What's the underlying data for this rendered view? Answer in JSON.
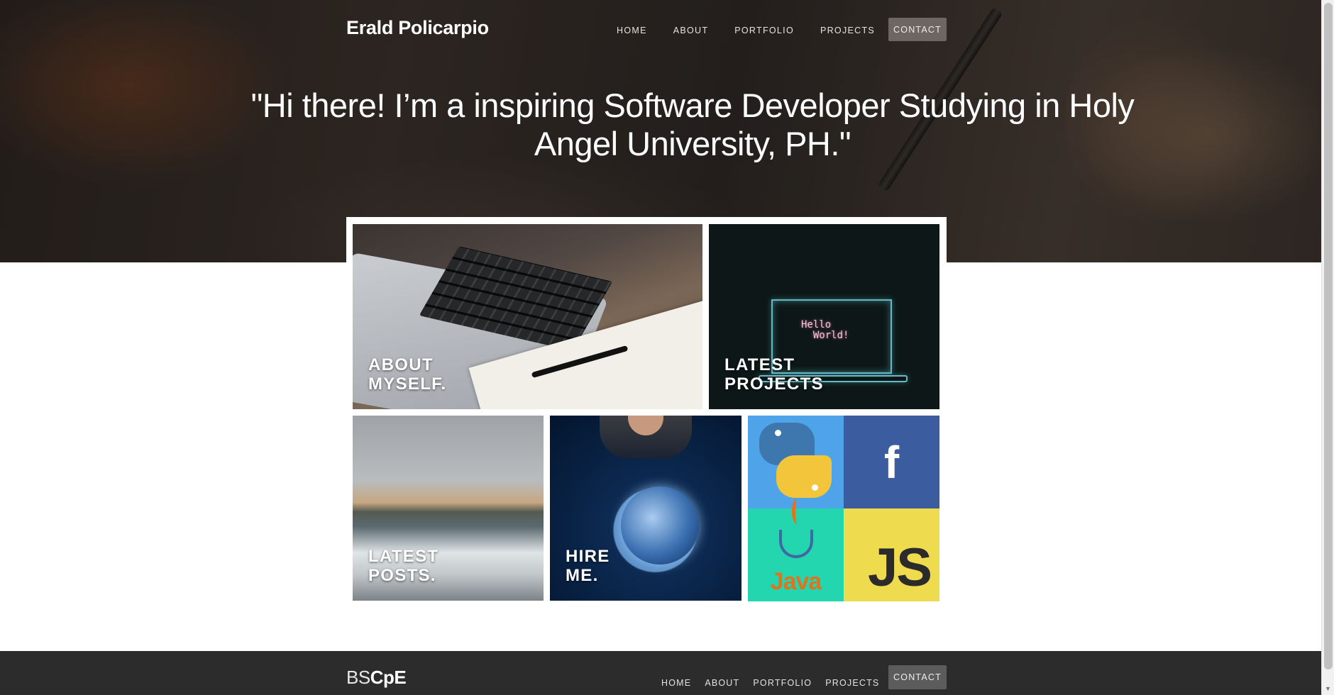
{
  "header": {
    "brand": "Erald Policarpio",
    "nav": [
      "HOME",
      "ABOUT",
      "PORTFOLIO",
      "PROJECTS"
    ],
    "contact_label": "CONTACT"
  },
  "hero": {
    "quote": "\"Hi there! I’m a inspiring Software Developer Studying in Holy Angel University, PH.\""
  },
  "tiles": {
    "about_line1": "ABOUT",
    "about_line2": "MYSELF.",
    "projects_line1": "LATEST",
    "projects_line2": "PROJECTS",
    "projects_screen_text": "Hello\n  World!",
    "posts_line1": "LATEST",
    "posts_line2": "POSTS.",
    "hire_line1": "HIRE",
    "hire_line2": "ME.",
    "langs": {
      "facebook_glyph": "f",
      "java_word": "Java",
      "js_word": "JS"
    }
  },
  "footer": {
    "brand_light": "BS",
    "brand_bold": "CpE",
    "nav": [
      "HOME",
      "ABOUT",
      "PORTFOLIO",
      "PROJECTS"
    ],
    "contact_label": "CONTACT"
  },
  "colors": {
    "footer_bg": "#2c2c2c",
    "python_bg": "#4fa4e9",
    "facebook_bg": "#3b5c9f",
    "java_bg": "#24d6b0",
    "js_bg": "#efdc4e"
  }
}
